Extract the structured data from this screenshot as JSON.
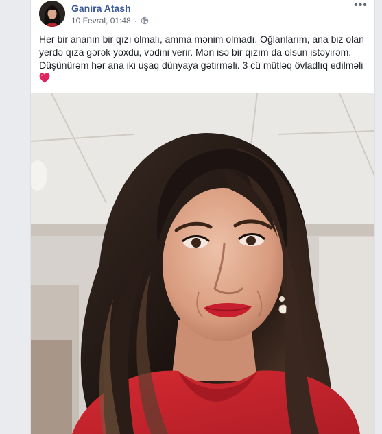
{
  "post": {
    "author": "Ganira Atash",
    "timestamp": "10 Fevral, 01:48",
    "separator": "·",
    "privacy_icon": "globe-icon",
    "more_label": "•••",
    "text": "Her bir ananın bir qızı olmalı, amma mənim olmadı. Oğlanlarım, ana biz olan yerdə qıza gərək yoxdu, vədini verir. Mən isə bir qızım da olsun istəyirəm. Düşünürəm hər ana iki uşaq dünyaya gətirməli. 3 cü mütləq övladlıq edilməli",
    "emoji": "red-heart-icon"
  },
  "colors": {
    "author_link": "#385898",
    "heart": "#e0245e"
  }
}
